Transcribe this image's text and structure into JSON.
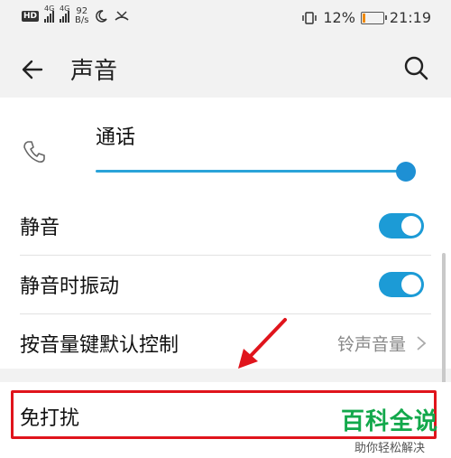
{
  "status_bar": {
    "hd": "HD",
    "net1": "4G",
    "net2": "4G",
    "speed_value": "92",
    "speed_unit": "B/s",
    "battery": "12%",
    "time": "21:19",
    "battery_level": 0.12,
    "battery_color": "#f08a00"
  },
  "header": {
    "title": "声音"
  },
  "call_volume": {
    "label": "通话",
    "level": 1.0
  },
  "settings": [
    {
      "label": "静音",
      "toggle_on": true
    },
    {
      "label": "静音时振动",
      "toggle_on": true
    },
    {
      "label": "按音量键默认控制",
      "value": "铃声音量"
    }
  ],
  "dnd": {
    "label": "免打扰"
  },
  "watermark": {
    "main": "百科全说",
    "sub": "助你轻松解决"
  },
  "colors": {
    "accent": "#1c9bd6",
    "highlight": "#e0141c",
    "watermark": "#12a84b"
  }
}
